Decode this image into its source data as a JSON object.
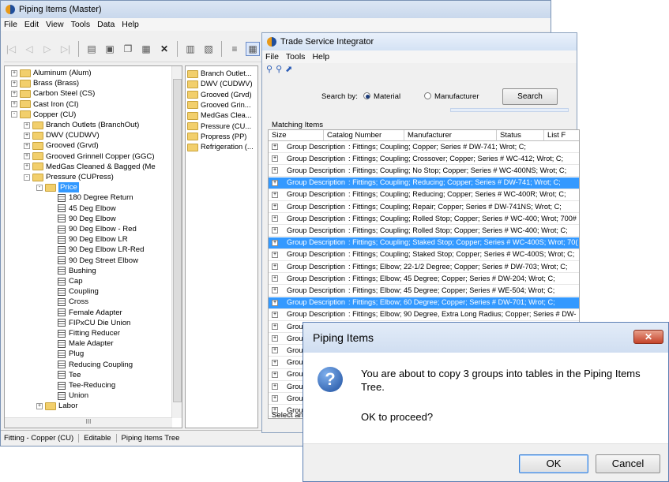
{
  "main": {
    "title": "Piping Items (Master)",
    "menu": [
      "File",
      "Edit",
      "View",
      "Tools",
      "Data",
      "Help"
    ],
    "tree": [
      {
        "label": "Aluminum (Alum)",
        "level": 1,
        "pm": "+",
        "kind": "folder"
      },
      {
        "label": "Brass (Brass)",
        "level": 1,
        "pm": "+",
        "kind": "folder"
      },
      {
        "label": "Carbon Steel (CS)",
        "level": 1,
        "pm": "+",
        "kind": "folder"
      },
      {
        "label": "Cast Iron (CI)",
        "level": 1,
        "pm": "+",
        "kind": "folder"
      },
      {
        "label": "Copper (CU)",
        "level": 1,
        "pm": "-",
        "kind": "folder"
      },
      {
        "label": "Branch Outlets (BranchOut)",
        "level": 2,
        "pm": "+",
        "kind": "folder"
      },
      {
        "label": "DWV (CUDWV)",
        "level": 2,
        "pm": "+",
        "kind": "folder"
      },
      {
        "label": "Grooved (Grvd)",
        "level": 2,
        "pm": "+",
        "kind": "folder"
      },
      {
        "label": "Grooved Grinnell Copper (GGC)",
        "level": 2,
        "pm": "+",
        "kind": "folder"
      },
      {
        "label": "MedGas Cleaned & Bagged (Me",
        "level": 2,
        "pm": "+",
        "kind": "folder"
      },
      {
        "label": "Pressure (CUPress)",
        "level": 2,
        "pm": "-",
        "kind": "folder"
      },
      {
        "label": "Price",
        "level": 3,
        "pm": "-",
        "kind": "folder",
        "selected": true
      },
      {
        "label": "180 Degree Return",
        "level": 4,
        "kind": "table"
      },
      {
        "label": "45 Deg Elbow",
        "level": 4,
        "kind": "table"
      },
      {
        "label": "90 Deg Elbow",
        "level": 4,
        "kind": "table"
      },
      {
        "label": "90 Deg Elbow - Red",
        "level": 4,
        "kind": "table"
      },
      {
        "label": "90 Deg Elbow LR",
        "level": 4,
        "kind": "table"
      },
      {
        "label": "90 Deg Elbow LR-Red",
        "level": 4,
        "kind": "table"
      },
      {
        "label": "90 Deg Street Elbow",
        "level": 4,
        "kind": "table"
      },
      {
        "label": "Bushing",
        "level": 4,
        "kind": "table"
      },
      {
        "label": "Cap",
        "level": 4,
        "kind": "table"
      },
      {
        "label": "Coupling",
        "level": 4,
        "kind": "table"
      },
      {
        "label": "Cross",
        "level": 4,
        "kind": "table"
      },
      {
        "label": "Female Adapter",
        "level": 4,
        "kind": "table"
      },
      {
        "label": "FIPxCU Die Union",
        "level": 4,
        "kind": "table"
      },
      {
        "label": "Fitting Reducer",
        "level": 4,
        "kind": "table"
      },
      {
        "label": "Male Adapter",
        "level": 4,
        "kind": "table"
      },
      {
        "label": "Plug",
        "level": 4,
        "kind": "table"
      },
      {
        "label": "Reducing Coupling",
        "level": 4,
        "kind": "table"
      },
      {
        "label": "Tee",
        "level": 4,
        "kind": "table"
      },
      {
        "label": "Tee-Reducing",
        "level": 4,
        "kind": "table"
      },
      {
        "label": "Union",
        "level": 4,
        "kind": "table"
      },
      {
        "label": "Labor",
        "level": 3,
        "pm": "+",
        "kind": "folder"
      }
    ],
    "hscroll_glyph": "III",
    "list": [
      "Branch Outlet...",
      "DWV (CUDWV)",
      "Grooved (Grvd)",
      "Grooved Grin...",
      "MedGas Clea...",
      "Pressure (CU...",
      "Propress (PP)",
      "Refrigeration (..."
    ],
    "status": [
      "Fitting - Copper (CU)",
      "Editable",
      "Piping Items Tree"
    ]
  },
  "tsi": {
    "title": "Trade Service Integrator",
    "menu": [
      "File",
      "Tools",
      "Help"
    ],
    "search_by": "Search by:",
    "opt_material": "Material",
    "opt_manufacturer": "Manufacturer",
    "search_btn": "Search",
    "matching_label": "Matching Items",
    "columns": [
      "Size",
      "Catalog Number",
      "Manufacturer",
      "Status",
      "List F"
    ],
    "row_label": "Group Description",
    "rows": [
      {
        "text": ": Fittings; Coupling; Copper; Series # DW-741; Wrot; C;",
        "hl": false
      },
      {
        "text": ": Fittings; Coupling; Crossover; Copper; Series # WC-412; Wrot; C;",
        "hl": false
      },
      {
        "text": ": Fittings; Coupling; No Stop; Copper; Series # WC-400NS; Wrot; C;",
        "hl": false
      },
      {
        "text": ": Fittings; Coupling; Reducing; Copper; Series # DW-741; Wrot; C;",
        "hl": true
      },
      {
        "text": ": Fittings; Coupling; Reducing; Copper; Series # WC-400R; Wrot; C;",
        "hl": false
      },
      {
        "text": ": Fittings; Coupling; Repair; Copper; Series # DW-741NS; Wrot; C;",
        "hl": false
      },
      {
        "text": ": Fittings; Coupling; Rolled Stop; Copper; Series # WC-400; Wrot; 700#",
        "hl": false
      },
      {
        "text": ": Fittings; Coupling; Rolled Stop; Copper; Series # WC-400; Wrot; C;",
        "hl": false
      },
      {
        "text": ": Fittings; Coupling; Staked Stop; Copper; Series # WC-400S; Wrot; 70(",
        "hl": true
      },
      {
        "text": ": Fittings; Coupling; Staked Stop; Copper; Series # WC-400S; Wrot; C;",
        "hl": false
      },
      {
        "text": ": Fittings; Elbow; 22-1/2 Degree; Copper; Series # DW-703; Wrot; C;",
        "hl": false
      },
      {
        "text": ": Fittings; Elbow; 45 Degree; Copper; Series # DW-204; Wrot; C;",
        "hl": false
      },
      {
        "text": ": Fittings; Elbow; 45 Degree; Copper; Series # WE-504; Wrot; C;",
        "hl": false
      },
      {
        "text": ": Fittings; Elbow; 60 Degree; Copper; Series # DW-701; Wrot; C;",
        "hl": true
      },
      {
        "text": ": Fittings; Elbow; 90 Degree, Extra Long Radius; Copper; Series # DW-",
        "hl": false
      }
    ],
    "truncated_rows": [
      "Group",
      "Group",
      "Group",
      "Group",
      "Group",
      "Group",
      "Group",
      "Group"
    ],
    "footer_label": "Select an"
  },
  "dialog": {
    "title": "Piping Items",
    "close_glyph": "✕",
    "icon_glyph": "?",
    "message": "You are about to copy 3 groups into tables in the Piping Items Tree.",
    "question": "OK to proceed?",
    "ok": "OK",
    "cancel": "Cancel"
  },
  "colors": {
    "selection": "#3399ff",
    "folder": "#f2cf6c",
    "close": "#c5432a"
  }
}
